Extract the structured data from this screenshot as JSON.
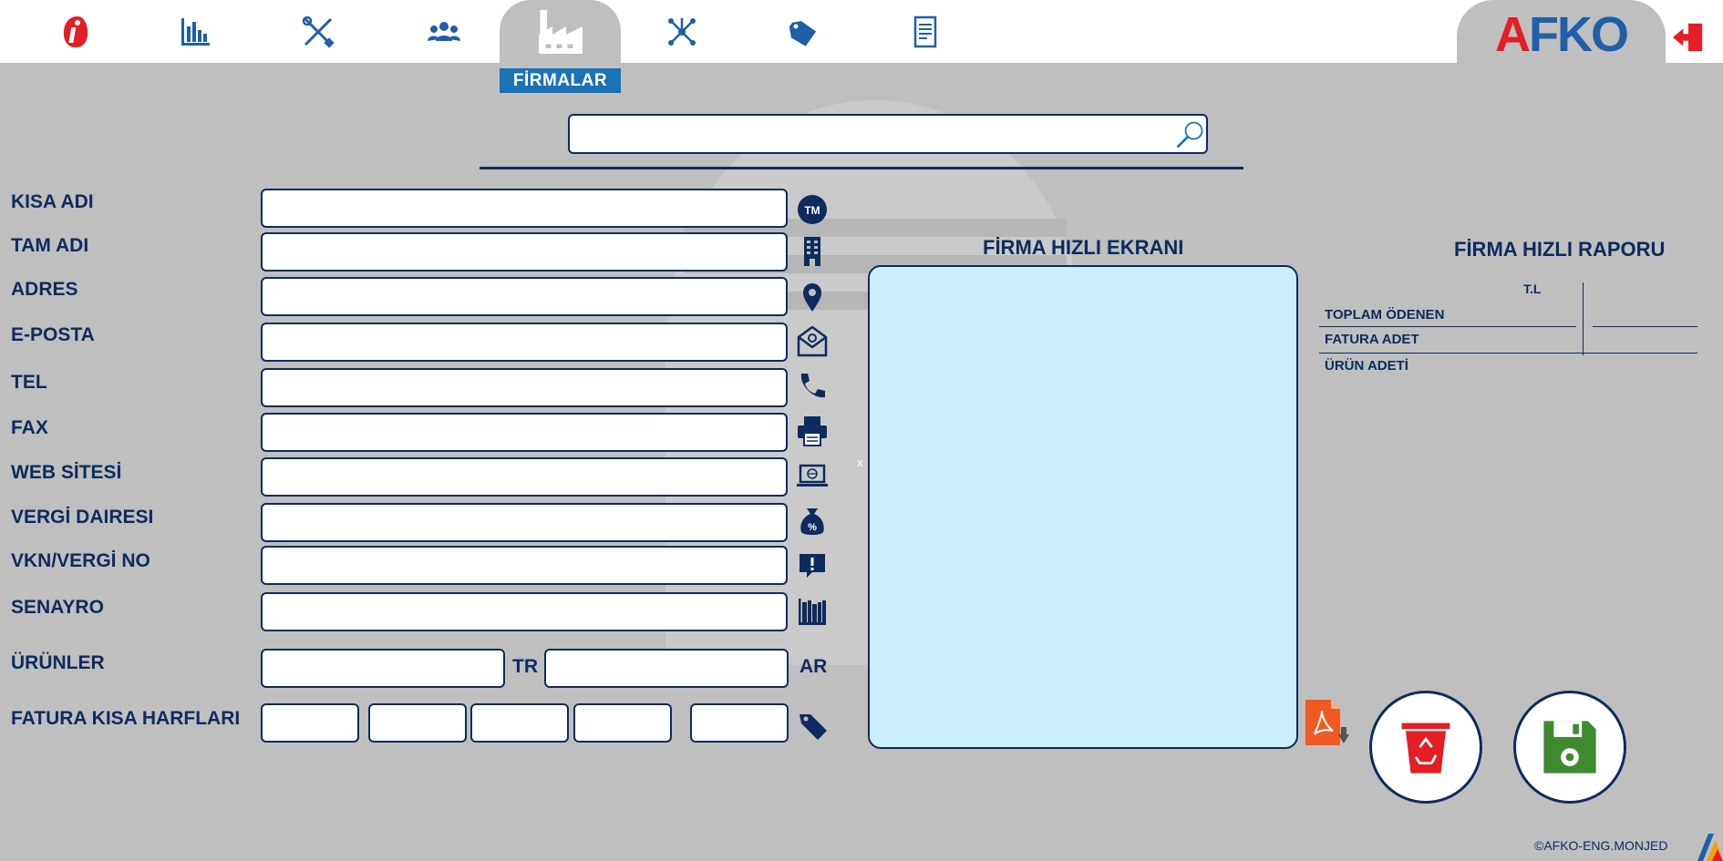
{
  "nav": {
    "items": [
      {
        "name": "home",
        "icon": "brand-i-icon"
      },
      {
        "name": "reports",
        "icon": "bar-chart-icon"
      },
      {
        "name": "tools",
        "icon": "tools-icon"
      },
      {
        "name": "users",
        "icon": "users-icon"
      },
      {
        "name": "companies",
        "icon": "factory-icon",
        "active": true
      },
      {
        "name": "network",
        "icon": "network-icon"
      },
      {
        "name": "tags",
        "icon": "tag-icon"
      },
      {
        "name": "documents",
        "icon": "document-icon"
      }
    ],
    "active_caption": "FİRMALAR"
  },
  "brand": {
    "letter_a": "A",
    "letters_fk": "FK",
    "letter_o": "O"
  },
  "search": {
    "value": "",
    "placeholder": ""
  },
  "form": {
    "fields": [
      {
        "label": "KISA ADI",
        "value": "",
        "icon": "trademark-icon"
      },
      {
        "label": "TAM ADI",
        "value": "",
        "icon": "building-icon"
      },
      {
        "label": "ADRES",
        "value": "",
        "icon": "location-pin-icon"
      },
      {
        "label": "E-POSTA",
        "value": "",
        "icon": "email-icon"
      },
      {
        "label": "TEL",
        "value": "",
        "icon": "phone-icon"
      },
      {
        "label": "FAX",
        "value": "",
        "icon": "printer-icon"
      },
      {
        "label": "WEB SİTESİ",
        "value": "",
        "icon": "web-icon"
      },
      {
        "label": "VERGİ DAIRESI",
        "value": "",
        "icon": "tax-bag-icon"
      },
      {
        "label": "VKN/VERGİ NO",
        "value": "",
        "icon": "alert-message-icon"
      },
      {
        "label": "SENAYRO",
        "value": "",
        "icon": "books-icon"
      }
    ],
    "products": {
      "label": "ÜRÜNLER",
      "tr_label": "TR",
      "ar_label": "AR",
      "tr_value": "",
      "ar_value": ""
    },
    "invoice_letters": {
      "label": "FATURA KISA HARFLARI",
      "values": [
        "",
        "",
        "",
        "",
        ""
      ],
      "icon": "price-tag-icon"
    }
  },
  "quick_screen": {
    "title": "FİRMA HIZLI EKRANI",
    "close_mark": "x"
  },
  "quick_report": {
    "title": "FİRMA HIZLI RAPORU",
    "column": "T.L",
    "rows": [
      {
        "label": "TOPLAM ÖDENEN",
        "value": ""
      },
      {
        "label": "FATURA ADET",
        "value": ""
      },
      {
        "label": "ÜRÜN ADETİ",
        "value": ""
      }
    ]
  },
  "actions": {
    "pdf": "pdf-download-icon",
    "delete": "recycle-bin-icon",
    "save": "floppy-save-icon"
  },
  "colors": {
    "navy": "#0d2b5e",
    "accent_blue": "#1a73b8",
    "red": "#e31e24",
    "green": "#3f8a2f",
    "panel": "#cbeefc",
    "background": "#bfbfbf"
  },
  "footer": {
    "copyright": "©AFKO-ENG.MONJED"
  }
}
